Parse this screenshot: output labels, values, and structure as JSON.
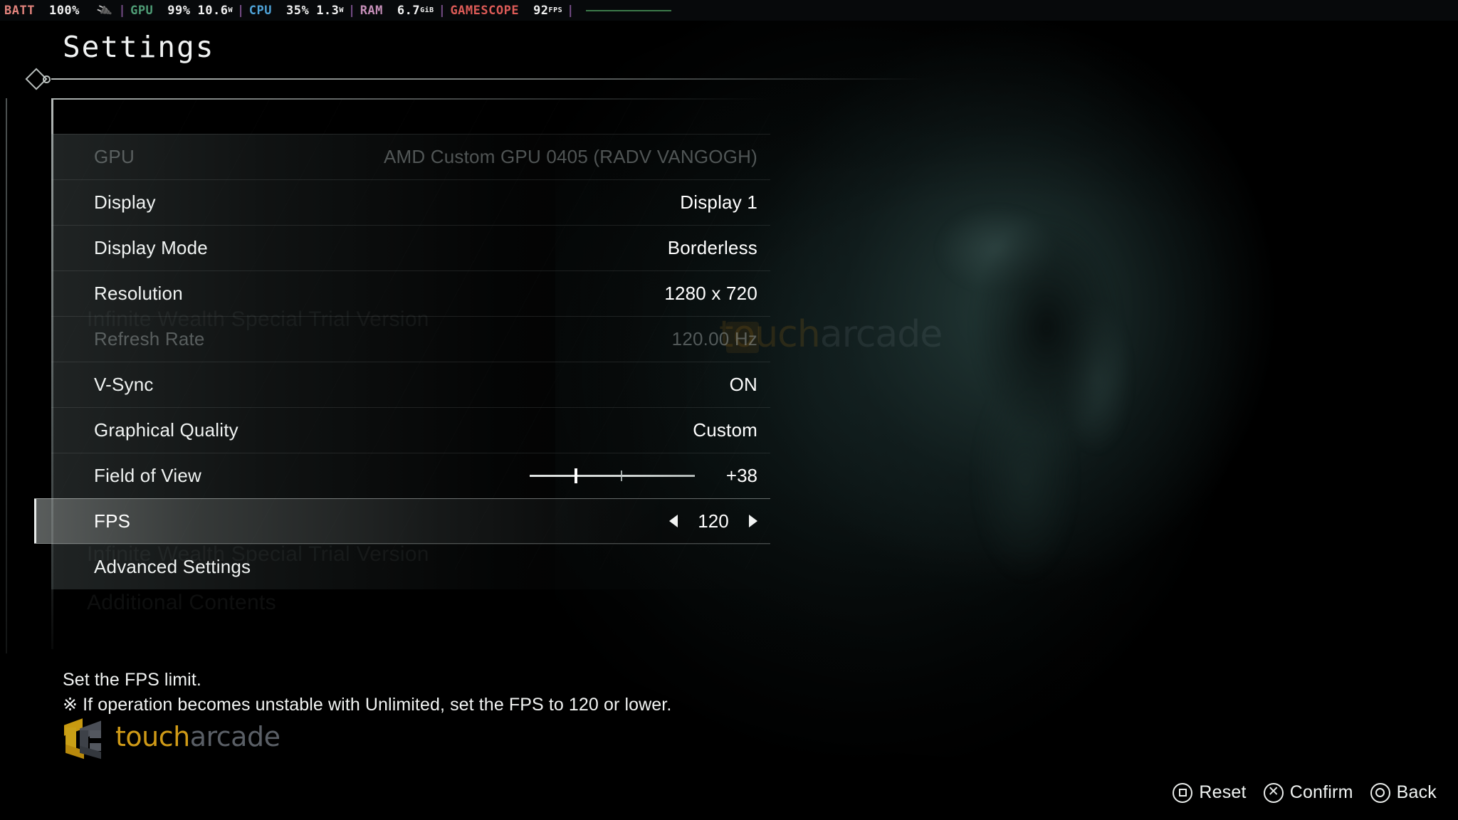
{
  "perf_overlay": {
    "battery_label": "BATT",
    "battery_value": "100%",
    "plug_icon": "power-plug-icon",
    "gpu_label": "GPU",
    "gpu_usage": "99%",
    "gpu_power": "10.6",
    "gpu_power_unit": "W",
    "cpu_label": "CPU",
    "cpu_usage": "35%",
    "cpu_power": "1.3",
    "cpu_power_unit": "W",
    "ram_label": "RAM",
    "ram_value": "6.7",
    "ram_unit": "GiB",
    "gamescope_label": "GAMESCOPE",
    "fps_value": "92",
    "fps_unit": "FPS"
  },
  "header": {
    "title": "Settings",
    "diamond_icon": "diamond-ornament-icon"
  },
  "ghost_text": {
    "line1": "Infinite Wealth Special Trial Version",
    "line2": "Additional Contents"
  },
  "background": {
    "watermark_touch": "touch",
    "watermark_arcade": "arcade"
  },
  "settings": {
    "rows": [
      {
        "label": "GPU",
        "value": "AMD Custom GPU 0405 (RADV VANGOGH)",
        "type": "text",
        "disabled": true,
        "selected": false
      },
      {
        "label": "Display",
        "value": "Display 1",
        "type": "text",
        "disabled": false,
        "selected": false
      },
      {
        "label": "Display Mode",
        "value": "Borderless",
        "type": "text",
        "disabled": false,
        "selected": false
      },
      {
        "label": "Resolution",
        "value": "1280 x 720",
        "type": "text",
        "disabled": false,
        "selected": false
      },
      {
        "label": "Refresh Rate",
        "value": "120.00 Hz",
        "type": "text",
        "disabled": true,
        "selected": false
      },
      {
        "label": "V-Sync",
        "value": "ON",
        "type": "text",
        "disabled": false,
        "selected": false
      },
      {
        "label": "Graphical Quality",
        "value": "Custom",
        "type": "text",
        "disabled": false,
        "selected": false
      },
      {
        "label": "Field of View",
        "value": "+38",
        "type": "slider",
        "disabled": false,
        "selected": false,
        "slider": {
          "fill_percent": 27,
          "tick_percent": 55
        }
      },
      {
        "label": "FPS",
        "value": "120",
        "type": "stepper",
        "disabled": false,
        "selected": true
      },
      {
        "label": "Advanced Settings",
        "value": "",
        "type": "link",
        "disabled": false,
        "selected": false
      }
    ]
  },
  "description": {
    "line1": "Set the FPS limit.",
    "line2": "※ If operation becomes unstable with Unlimited, set the FPS to 120 or lower."
  },
  "logo": {
    "touch": "touch",
    "arcade": "arcade"
  },
  "button_hints": [
    {
      "glyph": "square",
      "label": "Reset"
    },
    {
      "glyph": "cross",
      "label": "Confirm"
    },
    {
      "glyph": "circle",
      "label": "Back"
    }
  ],
  "colors": {
    "accent_gold": "#cf9a17",
    "panel_text": "#f0f3f2",
    "disabled_text": "#96a0a0",
    "overlay_bg": "#07090b"
  }
}
